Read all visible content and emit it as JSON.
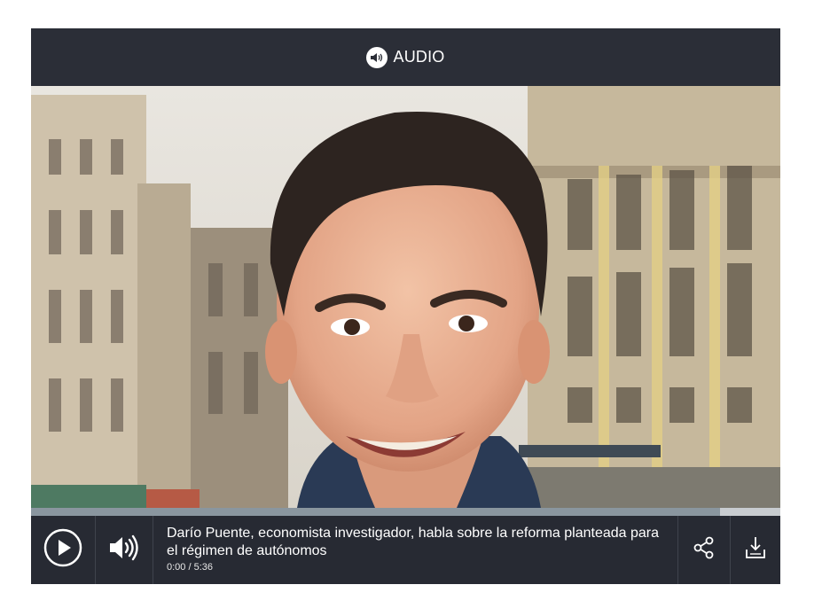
{
  "header": {
    "title": "AUDIO",
    "icon": "speaker-icon"
  },
  "photo": {
    "subject": "portrait-photo"
  },
  "progress": {
    "buffered_fraction": 0.92,
    "played_fraction": 0.0
  },
  "track": {
    "title": "Darío Puente, economista investigador, habla sobre la reforma planteada para el régimen de autónomos",
    "time": "0:00 / 5:36"
  },
  "controls": {
    "play_icon": "play-icon",
    "volume_icon": "volume-icon",
    "share_icon": "share-icon",
    "download_icon": "download-icon"
  },
  "colors": {
    "bar_bg": "#272a33",
    "progress_fill": "#8a969f",
    "progress_track": "#c8ccd0"
  }
}
